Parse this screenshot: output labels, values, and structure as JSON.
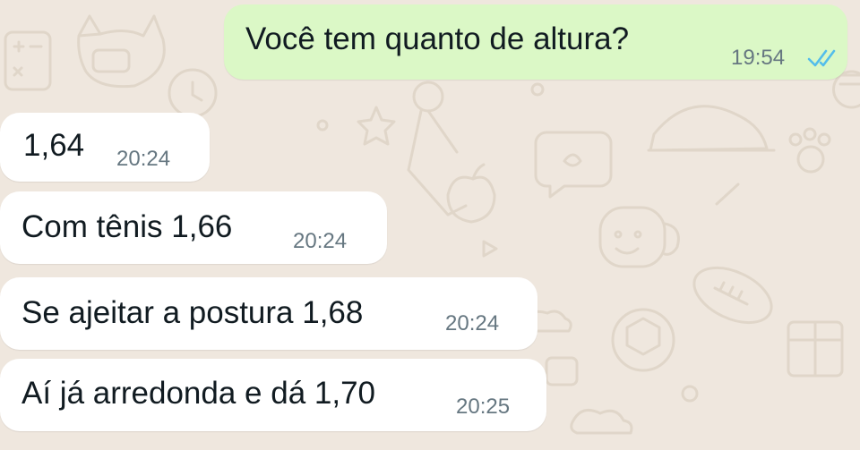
{
  "chat": {
    "outgoing": [
      {
        "text": "Você tem quanto de altura?",
        "time": "19:54",
        "status": "read",
        "status_icon": "double-check-icon",
        "status_color": "#53bdeb"
      }
    ],
    "incoming": [
      {
        "text": "1,64",
        "time": "20:24"
      },
      {
        "text": "Com tênis 1,66",
        "time": "20:24"
      },
      {
        "text": "Se ajeitar a postura 1,68",
        "time": "20:24"
      },
      {
        "text": "Aí já arredonda e dá 1,70",
        "time": "20:25"
      }
    ]
  },
  "colors": {
    "background": "#efe7de",
    "outgoing_bubble": "#dbf8c6",
    "incoming_bubble": "#ffffff",
    "text": "#111b21",
    "timestamp": "#667781"
  }
}
